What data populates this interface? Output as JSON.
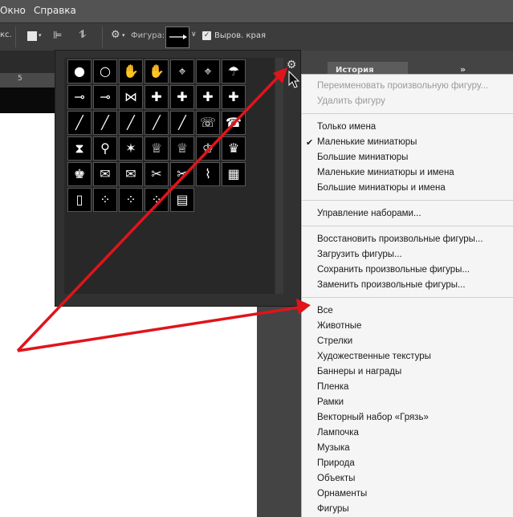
{
  "menubar": {
    "items": [
      "Окно",
      "Справка"
    ]
  },
  "options": {
    "prev_label": "кс.",
    "shape_label": "Фигура:",
    "smooth_label": "Выров. края"
  },
  "history_tab": "История",
  "ruler_mark": "5",
  "shape_grid": [
    [
      "bulb-filled",
      "bulb-outline",
      "hand-left",
      "hand-right",
      "foot-left",
      "foot-right",
      "umbrella"
    ],
    [
      "key-outline",
      "key-filled",
      "bow",
      "puzzle-1",
      "puzzle-2",
      "puzzle-3",
      "puzzle-4"
    ],
    [
      "pencil-1",
      "pencil-2",
      "pencil-3",
      "pencil-4",
      "pencil-5",
      "phone-outline",
      "phone-filled"
    ],
    [
      "hourglass",
      "pushpin",
      "sheriff-star",
      "crown-1",
      "crown-2",
      "crown-3",
      "crown-4"
    ],
    [
      "chess-king",
      "envelope-filled",
      "envelope-outline",
      "scissors-1",
      "scissors-2",
      "paperclip",
      "stamp"
    ],
    [
      "frame",
      "grunge-1",
      "grunge-2",
      "grunge-3",
      "flag-usa"
    ]
  ],
  "shape_glyphs": {
    "bulb-filled": "●",
    "bulb-outline": "○",
    "hand-left": "✋",
    "hand-right": "✋",
    "foot-left": "⌖",
    "foot-right": "⌖",
    "umbrella": "☂",
    "key-outline": "⊸",
    "key-filled": "⊸",
    "bow": "⋈",
    "puzzle-1": "✚",
    "puzzle-2": "✚",
    "puzzle-3": "✚",
    "puzzle-4": "✚",
    "pencil-1": "╱",
    "pencil-2": "╱",
    "pencil-3": "╱",
    "pencil-4": "╱",
    "pencil-5": "╱",
    "phone-outline": "☏",
    "phone-filled": "☎",
    "hourglass": "⧗",
    "pushpin": "⚲",
    "sheriff-star": "✶",
    "crown-1": "♕",
    "crown-2": "♕",
    "crown-3": "♔",
    "crown-4": "♛",
    "chess-king": "♚",
    "envelope-filled": "✉",
    "envelope-outline": "✉",
    "scissors-1": "✂",
    "scissors-2": "✂",
    "paperclip": "⌇",
    "stamp": "▦",
    "frame": "▯",
    "grunge-1": "⁘",
    "grunge-2": "⁘",
    "grunge-3": "⁘",
    "flag-usa": "▤"
  },
  "context_menu": {
    "group1": [
      "Переименовать произвольную фигуру...",
      "Удалить фигуру"
    ],
    "group2": [
      "Только имена",
      "Маленькие миниатюры",
      "Большие миниатюры",
      "Маленькие миниатюры и имена",
      "Большие миниатюры и имена"
    ],
    "checked_item": "Маленькие миниатюры",
    "group3": [
      "Управление наборами..."
    ],
    "group4": [
      "Восстановить произвольные фигуры...",
      "Загрузить фигуры...",
      "Сохранить произвольные фигуры...",
      "Заменить произвольные фигуры..."
    ],
    "group5": [
      "Все",
      "Животные",
      "Стрелки",
      "Художественные текстуры",
      "Баннеры и награды",
      "Пленка",
      "Рамки",
      "Векторный набор «Грязь»",
      "Лампочка",
      "Музыка",
      "Природа",
      "Объекты",
      "Орнаменты",
      "Фигуры"
    ]
  },
  "colors": {
    "arrow": "#e0141b",
    "menu_bg": "#f5f5f5",
    "panel_bg": "#313131"
  }
}
